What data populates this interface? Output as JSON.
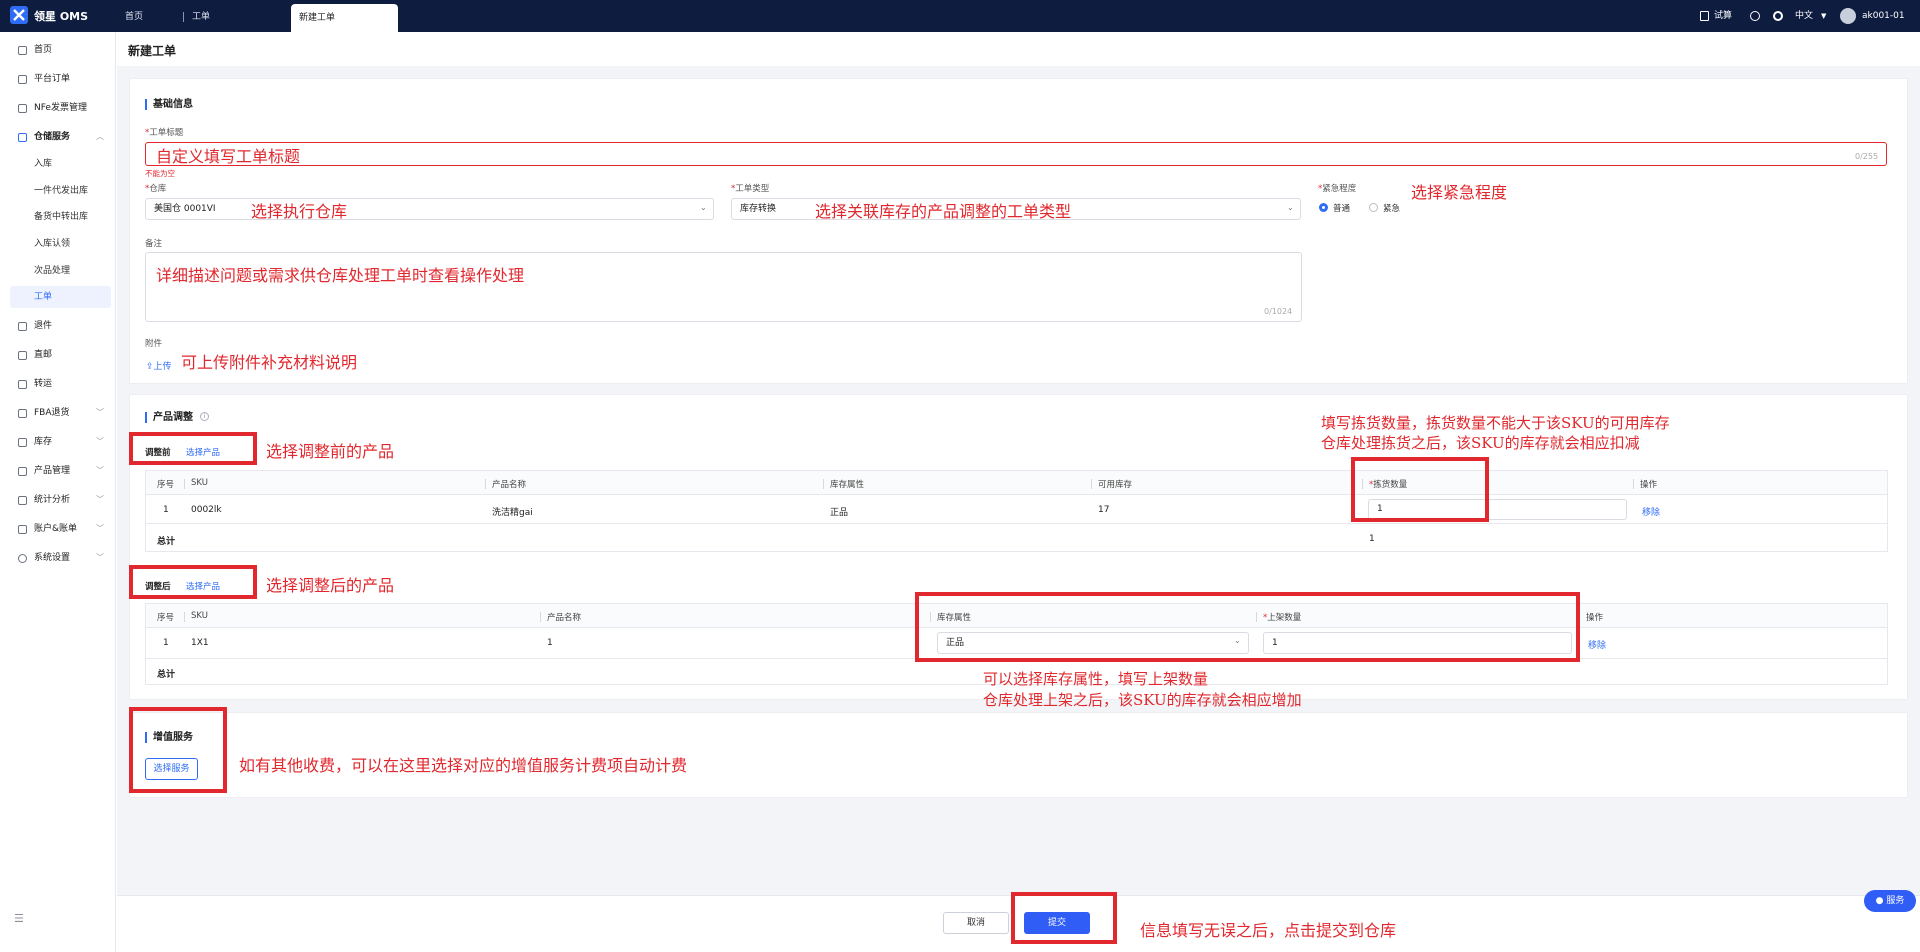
{
  "app": {
    "logo_text": "领星 OMS"
  },
  "topbar": {
    "tabs": [
      "首页",
      "工单"
    ],
    "active_tab": "新建工单",
    "calc_label": "试算",
    "language": "中文",
    "user": "ak001-01"
  },
  "sidebar": {
    "items": [
      {
        "label": "首页",
        "icon": "home-icon"
      },
      {
        "label": "平台订单",
        "icon": "order-icon"
      },
      {
        "label": "NFe发票管理",
        "icon": "invoice-icon"
      },
      {
        "label": "仓储服务",
        "icon": "warehouse-icon"
      },
      {
        "label": "退件",
        "icon": "return-icon"
      },
      {
        "label": "直邮",
        "icon": "mail-icon"
      },
      {
        "label": "转运",
        "icon": "transfer-icon"
      },
      {
        "label": "FBA退货",
        "icon": "fba-icon"
      },
      {
        "label": "库存",
        "icon": "inventory-icon"
      },
      {
        "label": "产品管理",
        "icon": "product-icon"
      },
      {
        "label": "统计分析",
        "icon": "stats-icon"
      },
      {
        "label": "账户&账单",
        "icon": "account-icon"
      },
      {
        "label": "系统设置",
        "icon": "settings-icon"
      }
    ],
    "sub_items": [
      "入库",
      "一件代发出库",
      "备货中转出库",
      "入库认领",
      "次品处理",
      "工单"
    ]
  },
  "page": {
    "title": "新建工单"
  },
  "basic": {
    "section_title": "基础信息",
    "title_label": "工单标题",
    "title_value": "",
    "title_counter": "0/255",
    "title_error": "不能为空",
    "warehouse_label": "仓库",
    "warehouse_value": "美国仓 0001VI",
    "type_label": "工单类型",
    "type_value": "库存转换",
    "urgency_label": "紧急程度",
    "urgency_options": [
      "普通",
      "紧急"
    ],
    "urgency_selected": "普通",
    "remark_label": "备注",
    "remark_counter": "0/1024",
    "attachment_label": "附件",
    "upload_label": "上传"
  },
  "adjust": {
    "section_title": "产品调整",
    "before_label": "调整前",
    "after_label": "调整后",
    "select_product": "选择产品",
    "before_headers": [
      "序号",
      "SKU",
      "产品名称",
      "库存属性",
      "可用库存",
      "拣货数量",
      "操作"
    ],
    "before_row": {
      "index": "1",
      "sku": "0002lk",
      "name": "洗洁精gai",
      "attr": "正品",
      "available": "17",
      "qty": "1",
      "action": "移除"
    },
    "before_total_label": "总计",
    "before_total_value": "1",
    "after_headers": [
      "序号",
      "SKU",
      "产品名称",
      "库存属性",
      "上架数量",
      "操作"
    ],
    "after_row": {
      "index": "1",
      "sku": "1X1",
      "name": "1",
      "attr": "正品",
      "qty": "1",
      "action": "移除"
    },
    "after_total_label": "总计"
  },
  "vas": {
    "section_title": "增值服务",
    "select_label": "选择服务"
  },
  "footer": {
    "cancel": "取消",
    "submit": "提交"
  },
  "service_badge": "服务",
  "annotations": {
    "title": "自定义填写工单标题",
    "warehouse": "选择执行仓库",
    "type": "选择关联库存的产品调整的工单类型",
    "urgency": "选择紧急程度",
    "remark": "详细描述问题或需求供仓库处理工单时查看操作处理",
    "attachment": "可上传附件补充材料说明",
    "before": "选择调整前的产品",
    "qty_line1": "填写拣货数量，拣货数量不能大于该SKU的可用库存",
    "qty_line2": "仓库处理拣货之后，该SKU的库存就会相应扣减",
    "after": "选择调整后的产品",
    "attr_line1": "可以选择库存属性，填写上架数量",
    "attr_line2": "仓库处理上架之后，该SKU的库存就会相应增加",
    "vas": "如有其他收费，可以在这里选择对应的增值服务计费项自动计费",
    "submit": "信息填写无误之后，点击提交到仓库"
  },
  "colors": {
    "primary": "#2f5df6",
    "topbar": "#0e1c40",
    "annotation": "#e0282e"
  }
}
